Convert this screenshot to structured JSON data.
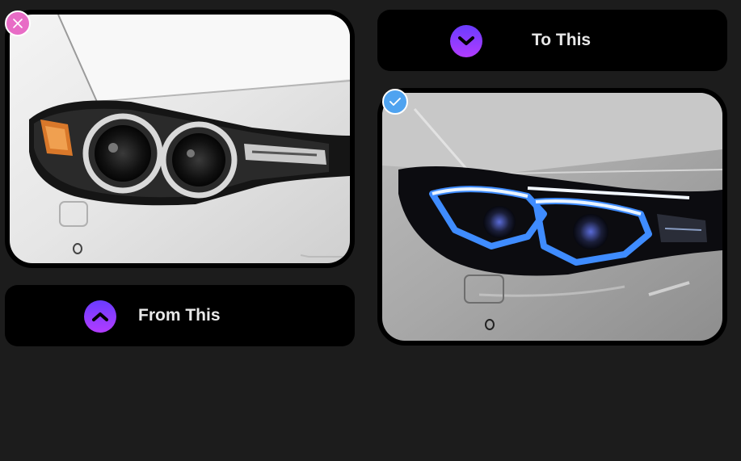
{
  "before": {
    "label": "From This",
    "icon": "chevron-up-icon",
    "badge_icon": "close-icon",
    "badge_color": "#e86cc6",
    "image": "stock-halogen-angel-eye-headlight"
  },
  "after": {
    "label": "To This",
    "icon": "chevron-down-icon",
    "badge_icon": "check-icon",
    "badge_color": "#4fa3f0",
    "image": "blue-drl-led-headlight"
  },
  "colors": {
    "background": "#1c1c1c",
    "panel": "#000000",
    "icon_gradient_top": "#6a3cff",
    "icon_gradient_bottom": "#b23cff",
    "text": "#e8e8e8"
  }
}
